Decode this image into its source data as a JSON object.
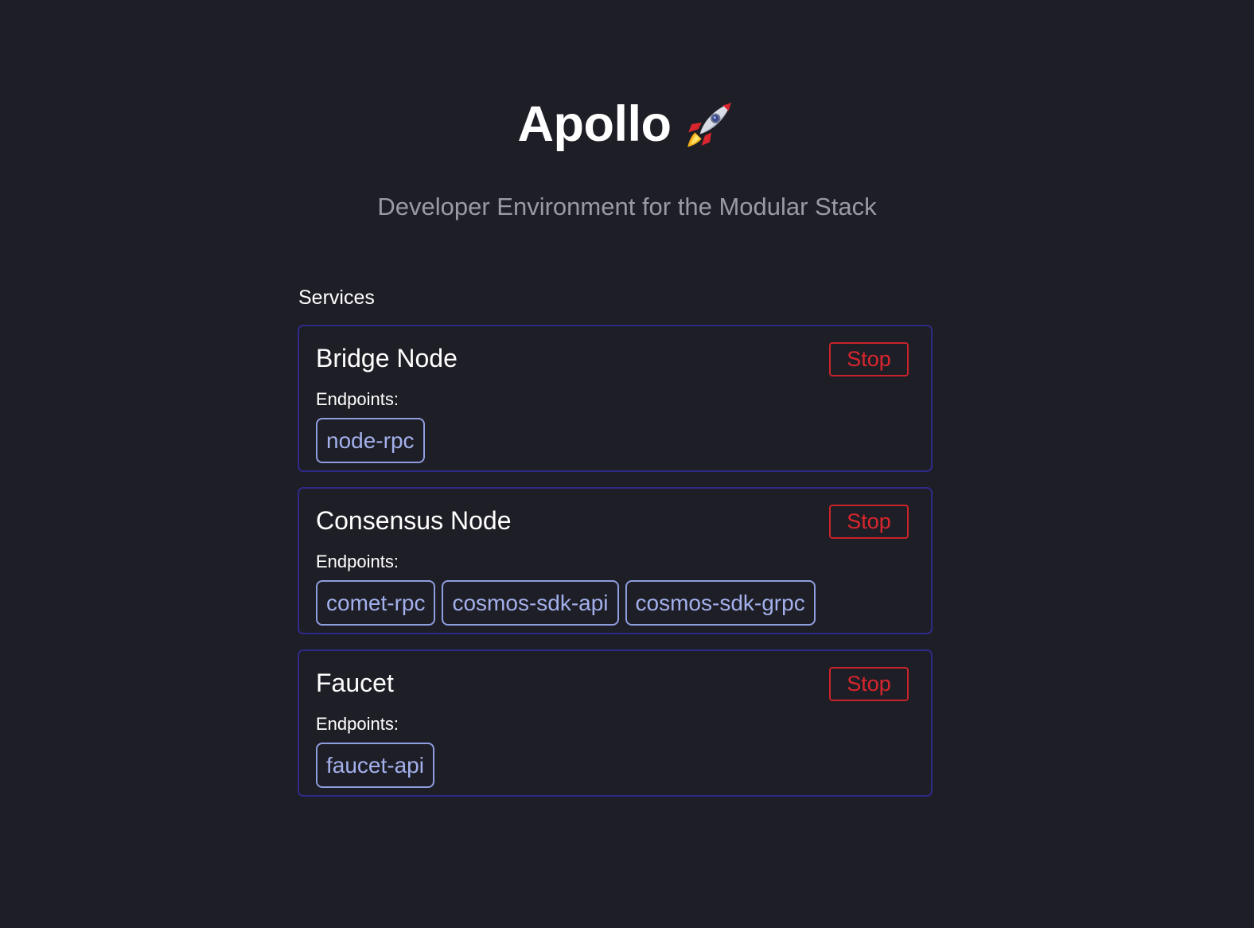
{
  "app": {
    "title": "Apollo",
    "title_icon": "rocket-icon",
    "subtitle": "Developer Environment for the Modular Stack"
  },
  "services": {
    "heading": "Services",
    "endpoints_label": "Endpoints:",
    "stop_label": "Stop",
    "items": [
      {
        "name": "Bridge Node",
        "endpoints": [
          "node-rpc"
        ]
      },
      {
        "name": "Consensus Node",
        "endpoints": [
          "comet-rpc",
          "cosmos-sdk-api",
          "cosmos-sdk-grpc"
        ]
      },
      {
        "name": "Faucet",
        "endpoints": [
          "faucet-api"
        ]
      }
    ]
  },
  "colors": {
    "background": "#1e1e26",
    "card_border": "#2f2a88",
    "stop_red": "#d9262e",
    "endpoint_blue": "#a3b0ec",
    "subtitle_gray": "#9a9aa6"
  }
}
